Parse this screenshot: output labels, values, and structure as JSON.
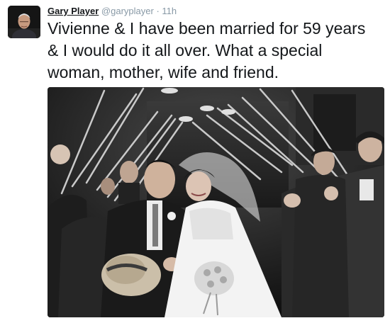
{
  "tweet": {
    "author_name": "Gary Player",
    "handle": "@garyplayer",
    "separator": "·",
    "timestamp": "11h",
    "text": "Vivienne & I have been married for 59 years & I would do it all over. What a special woman, mother, wife and friend."
  },
  "colors": {
    "name_text": "#14171a",
    "meta_text": "#8899a6",
    "body_text": "#14171a"
  },
  "icons": {
    "avatar": "avatar-photo",
    "media": "wedding-photo"
  }
}
